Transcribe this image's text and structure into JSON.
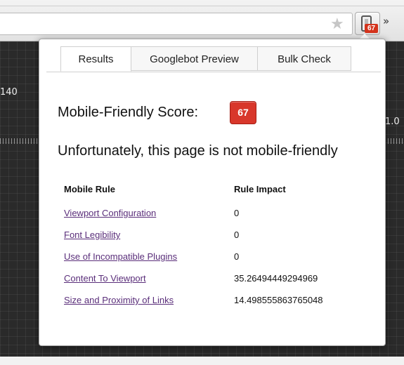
{
  "browser": {
    "overflow_icon": "»",
    "extension_badge": "67"
  },
  "background": {
    "ruler_label_left": "140",
    "ruler_label_right": "1.0"
  },
  "popup": {
    "tabs": [
      {
        "label": "Results",
        "active": true
      },
      {
        "label": "Googlebot Preview",
        "active": false
      },
      {
        "label": "Bulk Check",
        "active": false
      }
    ],
    "score_label": "Mobile-Friendly Score:",
    "score_value": "67",
    "verdict": "Unfortunately, this page is not mobile-friendly",
    "table": {
      "headers": [
        "Mobile Rule",
        "Rule Impact"
      ],
      "rows": [
        {
          "rule": "Viewport Configuration",
          "impact": "0"
        },
        {
          "rule": "Font Legibility",
          "impact": "0"
        },
        {
          "rule": "Use of Incompatible Plugins",
          "impact": "0"
        },
        {
          "rule": "Content To Viewport",
          "impact": "35.26494449294969"
        },
        {
          "rule": "Size and Proximity of Links",
          "impact": "14.498555863765048"
        }
      ]
    }
  },
  "colors": {
    "badge_red": "#d8372b",
    "link_purple": "#5a2e7a"
  }
}
